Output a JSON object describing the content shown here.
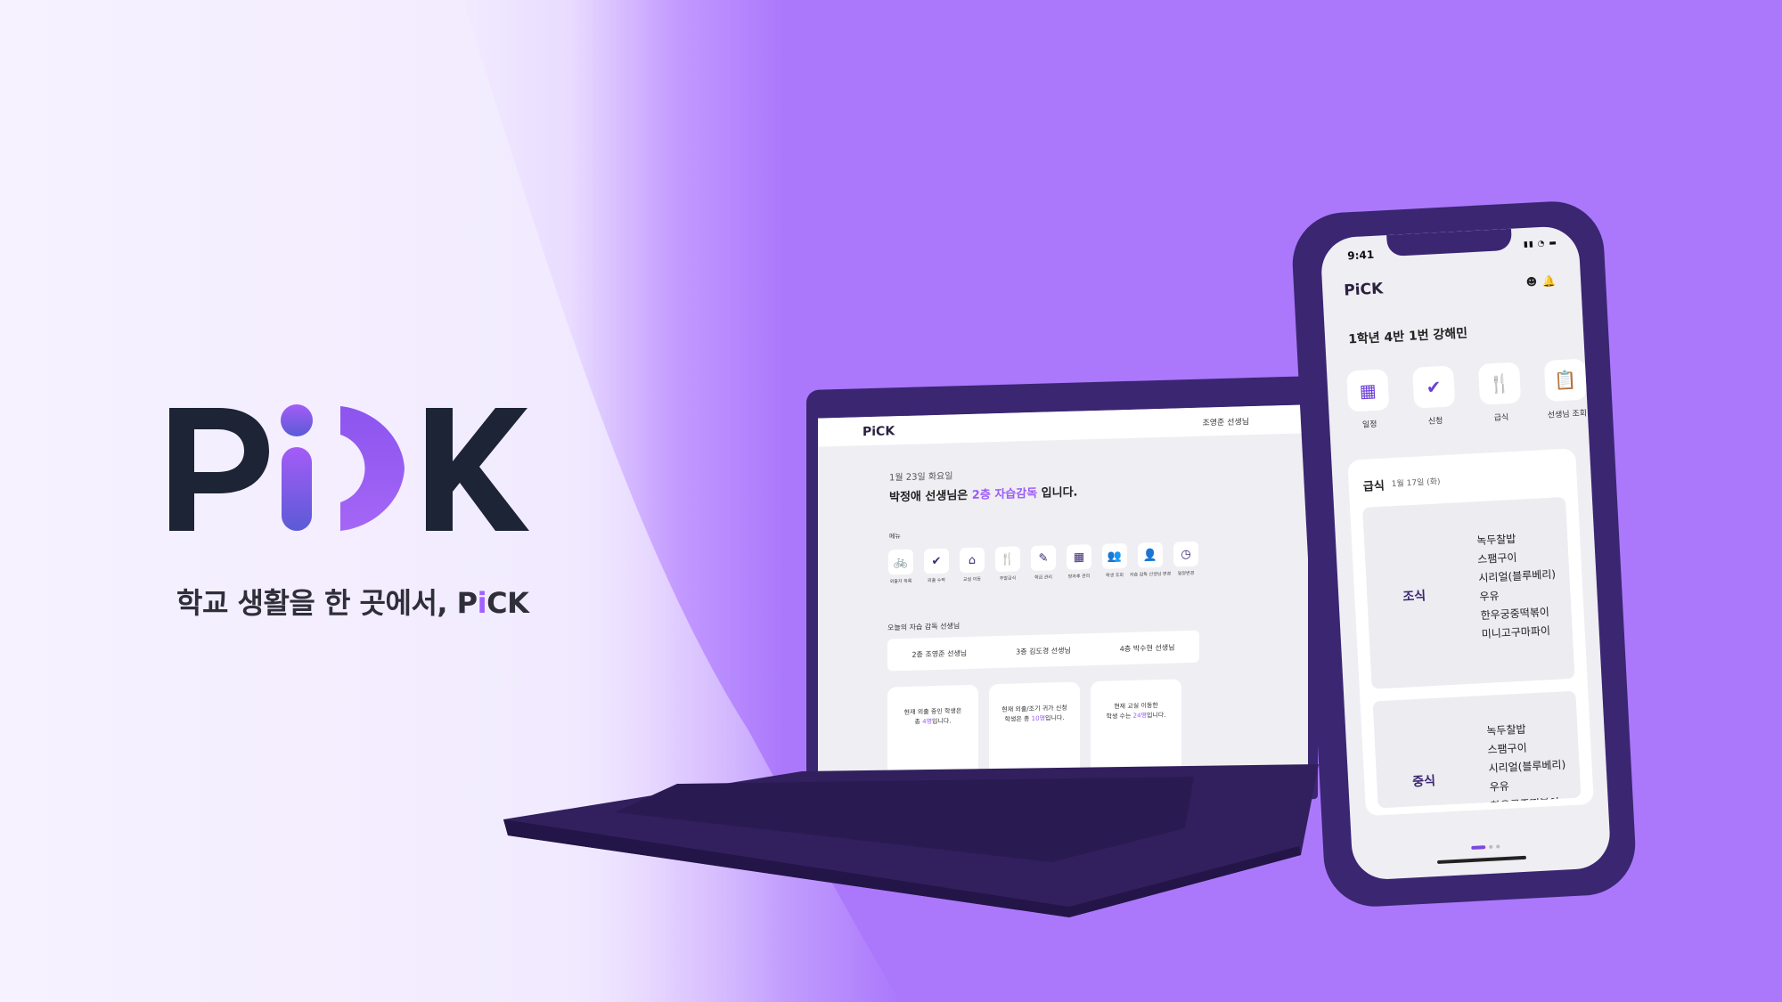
{
  "brand": {
    "logo_text": "PiCK",
    "tagline_prefix": "학교 생활을 한 곳에서, P",
    "tagline_i": "i",
    "tagline_suffix": "CK",
    "accent_color": "#a260ff",
    "background_color": "#ab78fc"
  },
  "laptop": {
    "logo": "PiCK",
    "user": "조영준 선생님",
    "date": "1월 23일 화요일",
    "headline_prefix": "박정애 선생님은 ",
    "headline_highlight": "2층 자습감독",
    "headline_suffix": " 입니다.",
    "menu_label": "메뉴",
    "menu": [
      {
        "icon": "bicycle-icon",
        "label": "외출자 목록"
      },
      {
        "icon": "check-icon",
        "label": "외출 수락"
      },
      {
        "icon": "classroom-icon",
        "label": "교실 이동"
      },
      {
        "icon": "meal-icon",
        "label": "주말급식"
      },
      {
        "icon": "edit-icon",
        "label": "학급 관리"
      },
      {
        "icon": "calendar-icon",
        "label": "방과후 관리"
      },
      {
        "icon": "students-icon",
        "label": "학생 조회"
      },
      {
        "icon": "teacher-icon",
        "label": "자습 감독 선생님 변경"
      },
      {
        "icon": "clock-icon",
        "label": "일정변경"
      }
    ],
    "supervision_title": "오늘의 자습 감독 선생님",
    "supervisors": [
      "2층 조영준 선생님",
      "3층 김도경 선생님",
      "4층 박수현 선생님"
    ],
    "cards": [
      {
        "line1": "현재 외출 중인 학생은",
        "line2_prefix": "총 ",
        "count": "4명",
        "line2_suffix": "입니다."
      },
      {
        "line1": "현재 외출/조기 귀가 신청",
        "line2_prefix": "학생은 총 ",
        "count": "10명",
        "line2_suffix": "입니다."
      },
      {
        "line1": "현재 교실 이동한",
        "line2_prefix": "학생 수는 ",
        "count": "24명",
        "line2_suffix": "입니다."
      }
    ]
  },
  "phone": {
    "time": "9:41",
    "logo": "PiCK",
    "student": "1학년 4반 1번 강해민",
    "menu": [
      {
        "icon": "calendar-icon",
        "label": "일정"
      },
      {
        "icon": "check-icon",
        "label": "신청"
      },
      {
        "icon": "meal-icon",
        "label": "급식"
      },
      {
        "icon": "clipboard-icon",
        "label": "선생님 조회"
      }
    ],
    "meal_title": "급식",
    "meal_date": "1월 17일 (화)",
    "meals": [
      {
        "name": "조식",
        "items": [
          "녹두찰밥",
          "스팸구이",
          "시리얼(블루베리)",
          "우유",
          "한우궁중떡볶이",
          "미니고구마파이"
        ]
      },
      {
        "name": "중식",
        "items": [
          "녹두찰밥",
          "스팸구이",
          "시리얼(블루베리)",
          "우유",
          "한우궁중떡볶이"
        ]
      }
    ]
  }
}
